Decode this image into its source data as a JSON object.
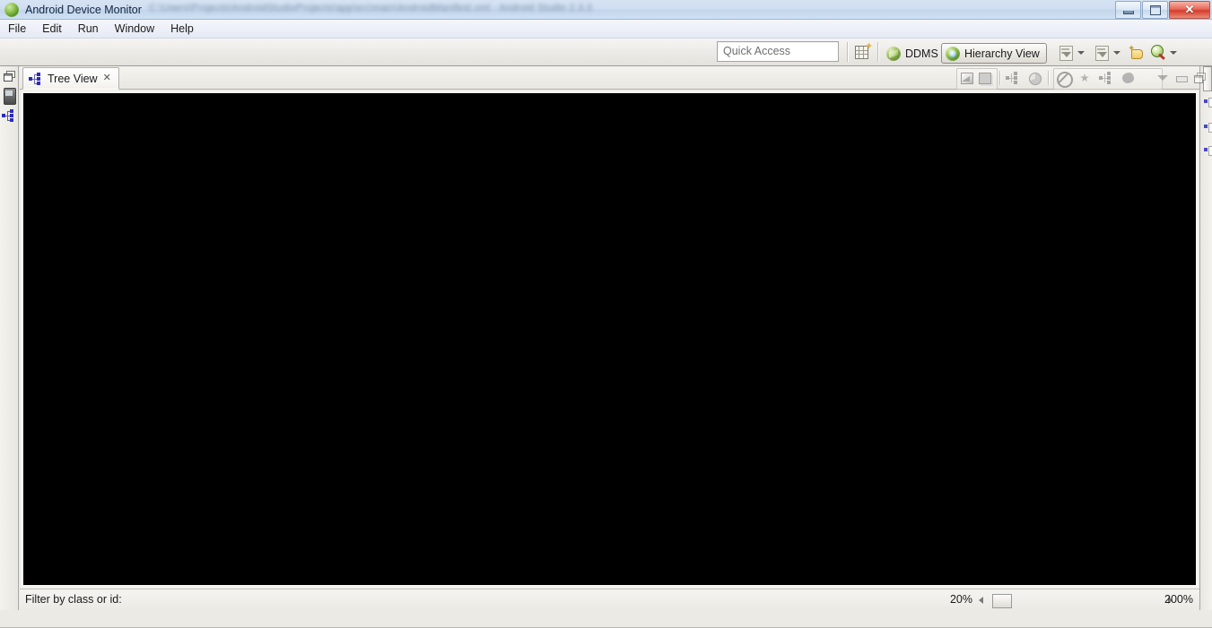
{
  "window": {
    "title": "Android Device Monitor",
    "title_blurred_suffix": "C:\\Users\\Projects\\AndroidStudioProjects\\app\\src\\main\\AndroidManifest.xml  -  Android Studio 2.3.3",
    "app_icon": "android-monitor-icon",
    "controls": {
      "minimize": "minimize-icon",
      "maximize": "maximize-icon",
      "close": "✕"
    }
  },
  "menubar": {
    "items": [
      {
        "label": "File",
        "name": "menu-file"
      },
      {
        "label": "Edit",
        "name": "menu-edit"
      },
      {
        "label": "Run",
        "name": "menu-run"
      },
      {
        "label": "Window",
        "name": "menu-window"
      },
      {
        "label": "Help",
        "name": "menu-help"
      }
    ]
  },
  "toolbar": {
    "quick_access_placeholder": "Quick Access",
    "quick_access_value": "",
    "open_perspective_icon": "open-perspective-icon",
    "perspectives": [
      {
        "label": "DDMS",
        "name": "perspective-ddms",
        "active": false,
        "icon": "ddms-icon"
      },
      {
        "label": "Hierarchy View",
        "name": "perspective-hierarchy-view",
        "active": true,
        "icon": "hierarchy-view-icon"
      }
    ],
    "right_tools": [
      {
        "name": "load-view-hierarchy-button",
        "icon": "download-window-icon"
      },
      {
        "name": "load-view-hierarchy-dropdown",
        "icon": "chevron-down-icon"
      },
      {
        "name": "inspect-screenshot-button",
        "icon": "window-screenshot-icon"
      },
      {
        "name": "inspect-screenshot-dropdown",
        "icon": "chevron-down-icon"
      },
      {
        "name": "pixel-perfect-button",
        "icon": "hand-pointer-icon"
      },
      {
        "name": "search-button",
        "icon": "magnifier-icon"
      },
      {
        "name": "search-dropdown",
        "icon": "chevron-down-icon"
      }
    ]
  },
  "left_fastview": {
    "items": [
      {
        "name": "restore-fastview-button",
        "icon": "restore-icon"
      },
      {
        "name": "fastview-devices",
        "icon": "device-icon"
      },
      {
        "name": "fastview-tree-view",
        "icon": "tree-view-icon"
      }
    ]
  },
  "right_fastview": {
    "items": [
      {
        "name": "fastview-stub-1",
        "icon": "tree-node-icon"
      },
      {
        "name": "fastview-stub-2",
        "icon": "tree-node-icon"
      },
      {
        "name": "fastview-stub-3",
        "icon": "tree-node-icon"
      },
      {
        "name": "fastview-stub-4",
        "icon": "properties-icon"
      }
    ]
  },
  "view": {
    "tab": {
      "label": "Tree View",
      "icon": "tree-view-icon",
      "close": "✕",
      "active": true
    },
    "toolbar": [
      {
        "name": "view-toolbar-layers-button",
        "icon": "layers-icon"
      },
      {
        "name": "view-toolbar-screen-button",
        "icon": "screen-icon"
      },
      {
        "name": "view-toolbar-tree-button",
        "icon": "tree-icon"
      },
      {
        "name": "view-toolbar-profile-button",
        "icon": "pie-profile-icon"
      },
      {
        "name": "view-toolbar-invalidate-button",
        "icon": "no-entry-icon"
      },
      {
        "name": "view-toolbar-request-layout-button",
        "icon": "burst-icon"
      },
      {
        "name": "view-toolbar-dump-theme-button",
        "icon": "tree-dump-icon"
      },
      {
        "name": "view-toolbar-capture-button",
        "icon": "blob-icon"
      },
      {
        "name": "view-menu-button",
        "icon": "view-menu-caret-icon"
      },
      {
        "name": "view-minimize-button",
        "icon": "minimize-icon"
      },
      {
        "name": "view-maximize-button",
        "icon": "maximize-icon"
      }
    ],
    "canvas": {
      "background_color": "#000000",
      "content": ""
    }
  },
  "statusbar": {
    "filter_label": "Filter by class or id:",
    "filter_value": "",
    "filter_placeholder": "",
    "zoom_min": "20%",
    "zoom_max": "200%",
    "zoom_value": 20,
    "slider_left_icon": "slider-left-arrow-icon",
    "slider_right_icon": "slider-right-arrow-icon"
  },
  "colors": {
    "titlebar": "#cfdef1",
    "menubar": "#eceff8",
    "toolbar": "#eceae6",
    "canvas": "#000000",
    "close_button": "#d33c2a",
    "tree_node": "#2b2bbf"
  }
}
